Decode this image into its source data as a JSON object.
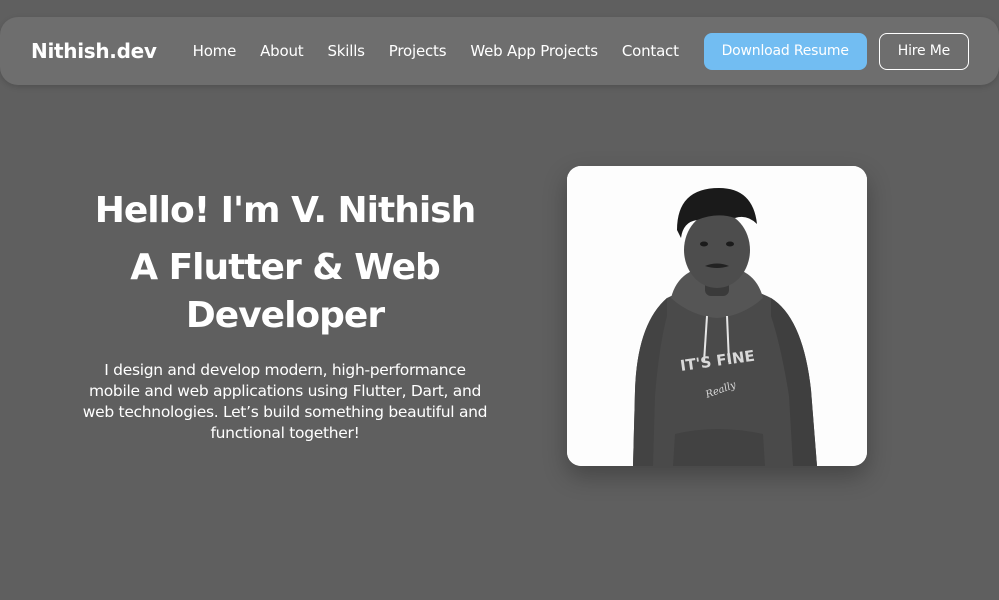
{
  "nav": {
    "brand": "Nithish.dev",
    "links": [
      "Home",
      "About",
      "Skills",
      "Projects",
      "Web App Projects",
      "Contact"
    ],
    "download_label": "Download Resume",
    "hire_label": "Hire Me"
  },
  "hero": {
    "greeting": "Hello! I'm V. Nithish",
    "role": "A Flutter & Web Developer",
    "description": "I design and develop modern, high-performance mobile and web applications using Flutter, Dart, and web technologies. Let’s build something beautiful and functional together!"
  },
  "profile": {
    "hoodie_print": "IT'S FINE",
    "hoodie_signature": "Really"
  },
  "colors": {
    "page_background": "#5f5f5f",
    "navbar_background": "#6e6e6e",
    "accent_button": "#72bdf2",
    "card_background": "#fdfdfd"
  }
}
